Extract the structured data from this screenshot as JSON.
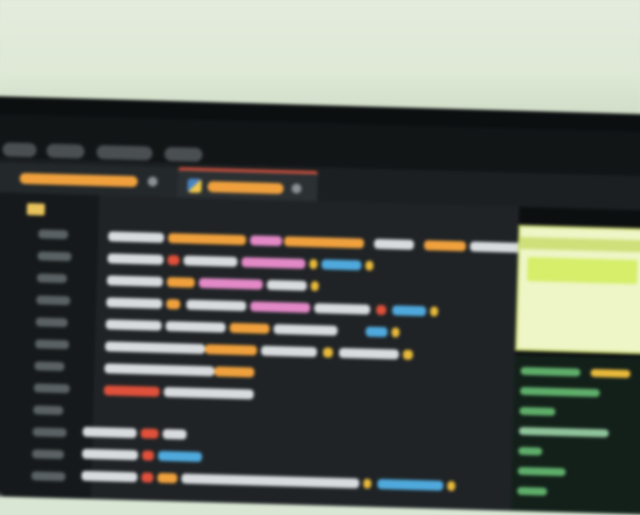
{
  "scene": {
    "description_visible": false
  },
  "menubar": {
    "items": [
      "",
      "",
      "",
      ""
    ],
    "window_title": ""
  },
  "tabs": [
    {
      "label": "",
      "active": false
    },
    {
      "label": "",
      "active": true
    }
  ],
  "colors": {
    "accent_tab": "#d6533f",
    "token_orange": "#f0a13d",
    "token_pink": "#e389c7",
    "token_blue": "#4fa9dc",
    "token_red": "#e0503a",
    "token_yellow": "#e8b93a",
    "token_white": "#d8dcde",
    "panel_highlight": "#eef5c6"
  },
  "icons": [
    "folder-icon",
    "python-file-icon",
    "close-icon"
  ]
}
